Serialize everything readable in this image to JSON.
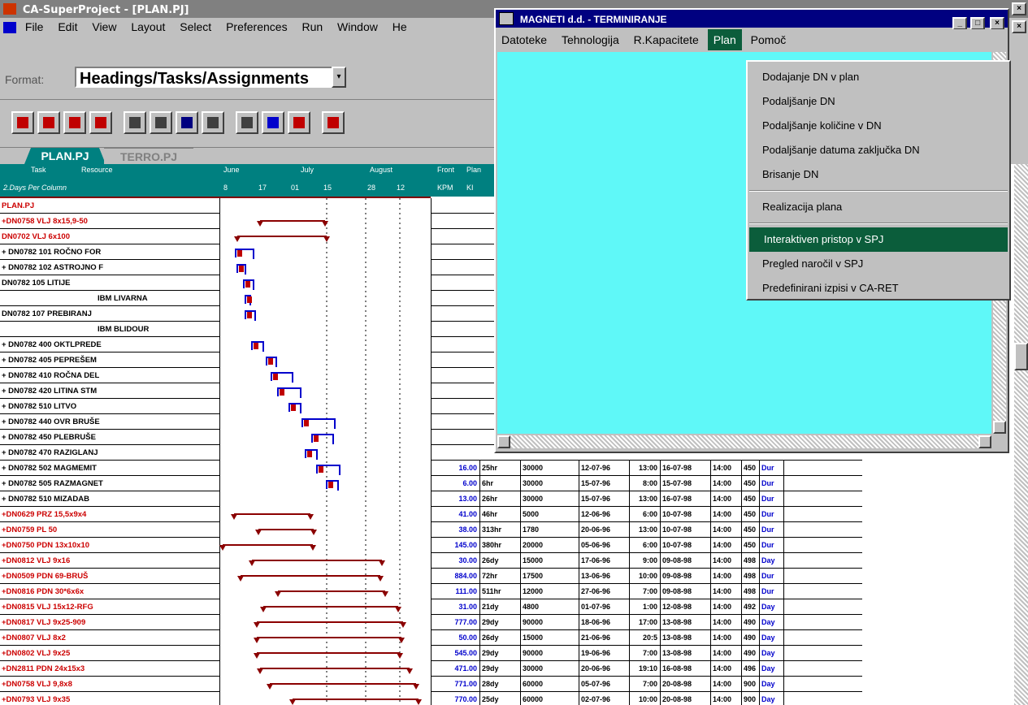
{
  "app_title": "CA-SuperProject - [PLAN.PJ]",
  "menu": [
    "File",
    "Edit",
    "View",
    "Layout",
    "Select",
    "Preferences",
    "Run",
    "Window",
    "He"
  ],
  "format": {
    "label": "Format:",
    "value": "Headings/Tasks/Assignments"
  },
  "tabs": [
    {
      "label": "PLAN.PJ"
    },
    {
      "label": "TERRO.PJ"
    }
  ],
  "grid_header": {
    "task": "Task",
    "resource": "Resource",
    "durs": "2.Days Per Column",
    "months": [
      "June",
      "July",
      "August"
    ],
    "days": [
      "8",
      "17",
      "01",
      "15",
      "28",
      "12"
    ],
    "front_labels": [
      "Front",
      "Plan"
    ],
    "front_sub": [
      "KPM",
      "KI"
    ]
  },
  "rows": [
    {
      "name": "PLAN.PJ",
      "color": "#cc0000"
    },
    {
      "name": "+DN0758 VLJ 8x15,9-50",
      "color": "#cc0000"
    },
    {
      "name": "DN0702 VLJ 6x100",
      "color": "#cc0000"
    },
    {
      "name": "+ DN0782 101 ROČNO FOR",
      "color": "#000"
    },
    {
      "name": "+ DN0782 102 ASTROJNO F",
      "color": "#000"
    },
    {
      "name": "DN0782 105 LITIJE",
      "color": "#000"
    },
    {
      "name": "IBM LIVARNA",
      "color": "#000"
    },
    {
      "name": "DN0782 107 PREBIRANJ",
      "color": "#000"
    },
    {
      "name": "IBM BLIDOUR",
      "color": "#000"
    },
    {
      "name": "+ DN0782 400 OKTLPREDE",
      "color": "#000"
    },
    {
      "name": "+ DN0782 405 PEPREŠEM",
      "color": "#000"
    },
    {
      "name": "+ DN0782 410 ROČNA DEL",
      "color": "#000"
    },
    {
      "name": "+ DN0782 420 LITINA STM",
      "color": "#000"
    },
    {
      "name": "+ DN0782 510 LITVO",
      "color": "#000"
    },
    {
      "name": "+ DN0782 440 OVR BRUŠE",
      "color": "#000"
    },
    {
      "name": "+ DN0782 450 PLEBRUŠE",
      "color": "#000"
    },
    {
      "name": "+ DN0782 470 RAZIGLANJ",
      "color": "#000"
    },
    {
      "name": "+ DN0782 502 MAGMEMIT",
      "color": "#000"
    },
    {
      "name": "+ DN0782 505 RAZMAGNET",
      "color": "#000"
    },
    {
      "name": "+ DN0782 510 MIZADAB",
      "color": "#000"
    },
    {
      "name": "+DN0629 PRZ 15,5x9x4",
      "color": "#cc0000"
    },
    {
      "name": "+DN0759 PL 50",
      "color": "#cc0000"
    },
    {
      "name": "+DN0750 PDN 13x10x10",
      "color": "#cc0000"
    },
    {
      "name": "+DN0812 VLJ 9x16",
      "color": "#cc0000"
    },
    {
      "name": "+DN0509 PDN 69-BRUŠ",
      "color": "#cc0000"
    },
    {
      "name": "+DN0816 PDN 30*6x6x",
      "color": "#cc0000"
    },
    {
      "name": "+DN0815 VLJ 15x12-RFG",
      "color": "#cc0000"
    },
    {
      "name": "+DN0817 VLJ 9x25-909",
      "color": "#cc0000"
    },
    {
      "name": "+DN0807 VLJ 8x2",
      "color": "#cc0000"
    },
    {
      "name": "+DN0802 VLJ 9x25",
      "color": "#cc0000"
    },
    {
      "name": "+DN2811 PDN 24x15x3",
      "color": "#cc0000"
    },
    {
      "name": "+DN0758 VLJ 9,8x8",
      "color": "#cc0000"
    },
    {
      "name": "+DN0793 VLJ 9x35",
      "color": "#cc0000"
    }
  ],
  "right_columns": [
    {
      "v1": "16.00",
      "v2": "25hr",
      "v3": "30000",
      "d1": "12-07-96",
      "t1": "13:00",
      "d2": "16-07-98",
      "t2": "14:00",
      "n": "450",
      "u": "Dur"
    },
    {
      "v1": "6.00",
      "v2": "6hr",
      "v3": "30000",
      "d1": "15-07-96",
      "t1": "8:00",
      "d2": "15-07-98",
      "t2": "14:00",
      "n": "450",
      "u": "Dur"
    },
    {
      "v1": "13.00",
      "v2": "26hr",
      "v3": "30000",
      "d1": "15-07-96",
      "t1": "13:00",
      "d2": "16-07-98",
      "t2": "14:00",
      "n": "450",
      "u": "Dur"
    },
    {
      "v1": "41.00",
      "v2": "46hr",
      "v3": "5000",
      "d1": "12-06-96",
      "t1": "6:00",
      "d2": "10-07-98",
      "t2": "14:00",
      "n": "450",
      "u": "Dur"
    },
    {
      "v1": "38.00",
      "v2": "313hr",
      "v3": "1780",
      "d1": "20-06-96",
      "t1": "13:00",
      "d2": "10-07-98",
      "t2": "14:00",
      "n": "450",
      "u": "Dur"
    },
    {
      "v1": "145.00",
      "v2": "380hr",
      "v3": "20000",
      "d1": "05-06-96",
      "t1": "6:00",
      "d2": "10-07-98",
      "t2": "14:00",
      "n": "450",
      "u": "Dur"
    },
    {
      "v1": "30.00",
      "v2": "26dy",
      "v3": "15000",
      "d1": "17-06-96",
      "t1": "9:00",
      "d2": "09-08-98",
      "t2": "14:00",
      "n": "498",
      "u": "Day"
    },
    {
      "v1": "884.00",
      "v2": "72hr",
      "v3": "17500",
      "d1": "13-06-96",
      "t1": "10:00",
      "d2": "09-08-98",
      "t2": "14:00",
      "n": "498",
      "u": "Dur"
    },
    {
      "v1": "111.00",
      "v2": "511hr",
      "v3": "12000",
      "d1": "27-06-96",
      "t1": "7:00",
      "d2": "09-08-98",
      "t2": "14:00",
      "n": "498",
      "u": "Dur"
    },
    {
      "v1": "31.00",
      "v2": "21dy",
      "v3": "4800",
      "d1": "01-07-96",
      "t1": "1:00",
      "d2": "12-08-98",
      "t2": "14:00",
      "n": "492",
      "u": "Day"
    },
    {
      "v1": "777.00",
      "v2": "29dy",
      "v3": "90000",
      "d1": "18-06-96",
      "t1": "17:00",
      "d2": "13-08-98",
      "t2": "14:00",
      "n": "490",
      "u": "Day"
    },
    {
      "v1": "50.00",
      "v2": "26dy",
      "v3": "15000",
      "d1": "21-06-96",
      "t1": "20:5",
      "d2": "13-08-98",
      "t2": "14:00",
      "n": "490",
      "u": "Day"
    },
    {
      "v1": "545.00",
      "v2": "29dy",
      "v3": "90000",
      "d1": "19-06-96",
      "t1": "7:00",
      "d2": "13-08-98",
      "t2": "14:00",
      "n": "490",
      "u": "Day"
    },
    {
      "v1": "471.00",
      "v2": "29dy",
      "v3": "30000",
      "d1": "20-06-96",
      "t1": "19:10",
      "d2": "16-08-98",
      "t2": "14:00",
      "n": "496",
      "u": "Day"
    },
    {
      "v1": "771.00",
      "v2": "28dy",
      "v3": "60000",
      "d1": "05-07-96",
      "t1": "7:00",
      "d2": "20-08-98",
      "t2": "14:00",
      "n": "900",
      "u": "Day"
    },
    {
      "v1": "770.00",
      "v2": "25dy",
      "v3": "60000",
      "d1": "02-07-96",
      "t1": "10:00",
      "d2": "20-08-98",
      "t2": "14:00",
      "n": "900",
      "u": "Day"
    }
  ],
  "dialog": {
    "title": "MAGNETI d.d. - TERMINIRANJE",
    "menu": [
      "Datoteke",
      "Tehnologija",
      "R.Kapacitete",
      "Plan",
      "Pomoč"
    ],
    "active_menu": "Plan"
  },
  "dropdown": {
    "items": [
      "Dodajanje DN v plan",
      "Podaljšanje DN",
      "Podaljšanje količine v DN",
      "Podaljšanje datuma zaključka DN",
      "Brisanje DN",
      "Realizacija plana",
      "Interaktiven pristop v SPJ",
      "Pregled naročil v SPJ",
      "Predefinirani izpisi v CA-RET"
    ],
    "selected": "Interaktiven pristop v SPJ"
  },
  "colors": {
    "teal": "#008080",
    "cyan": "#5ff8f8",
    "navy": "#000080",
    "dark_red": "#8b0000",
    "gantt_blue": "#0000cc",
    "highlight": "#0b5d3b"
  },
  "icons": [
    "app-icon",
    "minimize-icon",
    "maximize-icon",
    "close-icon"
  ]
}
